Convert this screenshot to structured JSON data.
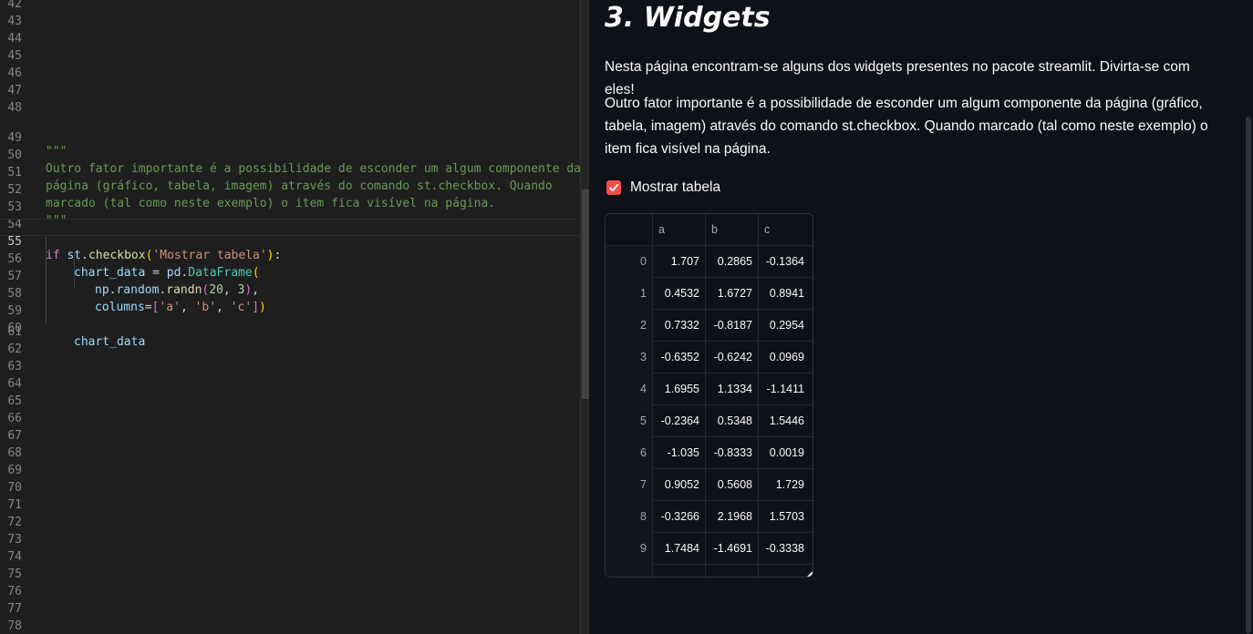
{
  "editor": {
    "blank_line_numbers": [
      "42",
      "43",
      "44",
      "45",
      "46",
      "47",
      "48"
    ],
    "lines": {
      "49": {
        "num": "49",
        "comment": "\"\"\""
      },
      "50": {
        "num": "50",
        "comment": "Outro fator importante é a possibilidade de esconder um algum componente da"
      },
      "51": {
        "num": "51",
        "comment": "página (gráfico, tabela, imagem) através do comando st.checkbox. Quando"
      },
      "52": {
        "num": "52",
        "comment": "marcado (tal como neste exemplo) o item fica visível na página."
      },
      "53": {
        "num": "53",
        "comment": "\"\"\""
      },
      "54": {
        "num": "54"
      },
      "55": {
        "num": "55",
        "kw_if": "if",
        "st": "st",
        "dot": ".",
        "fn": "checkbox",
        "lp": "(",
        "str": "'Mostrar tabela'",
        "rp": ")",
        "colon": ":"
      },
      "56": {
        "num": "56",
        "var": "chart_data",
        "eq": " = ",
        "pd": "pd",
        "dot": ".",
        "cls": "DataFrame",
        "lp": "("
      },
      "57": {
        "num": "57",
        "np": "np",
        "dot1": ".",
        "random": "random",
        "dot2": ".",
        "fn": "randn",
        "lp": "(",
        "n1": "20",
        "comma": ", ",
        "n2": "3",
        "rp": ")",
        "trail": ","
      },
      "58": {
        "num": "58",
        "param": "columns",
        "eq": "=",
        "lb": "[",
        "s1": "'a'",
        "c1": ", ",
        "s2": "'b'",
        "c2": ", ",
        "s3": "'c'",
        "rb": "]",
        "rp": ")"
      },
      "59": {
        "num": "59"
      },
      "60": {
        "num": "60",
        "var": "chart_data"
      }
    },
    "tail_line_numbers": [
      "61",
      "62",
      "63",
      "64",
      "65",
      "66",
      "67",
      "68",
      "69",
      "70",
      "71",
      "72",
      "73",
      "74",
      "75",
      "76",
      "77",
      "78"
    ]
  },
  "app": {
    "title": "3. Widgets",
    "paragraph1": "Nesta página encontram-se alguns dos widgets presentes no pacote streamlit. Divirta-se com eles!",
    "paragraph2": "Outro fator importante é a possibilidade de esconder um algum componente da página (gráfico, tabela, imagem) através do comando st.checkbox. Quando marcado (tal como neste exemplo) o item fica visível na página.",
    "checkbox": {
      "label": "Mostrar tabela",
      "checked": true,
      "color": "#ff4b4b"
    },
    "table": {
      "columns": [
        "a",
        "b",
        "c"
      ],
      "rows": [
        {
          "index": "0",
          "a": "1.707",
          "b": "0.2865",
          "c": "-0.1364"
        },
        {
          "index": "1",
          "a": "0.4532",
          "b": "1.6727",
          "c": "0.8941"
        },
        {
          "index": "2",
          "a": "0.7332",
          "b": "-0.8187",
          "c": "0.2954"
        },
        {
          "index": "3",
          "a": "-0.6352",
          "b": "-0.6242",
          "c": "0.0969"
        },
        {
          "index": "4",
          "a": "1.6955",
          "b": "1.1334",
          "c": "-1.1411"
        },
        {
          "index": "5",
          "a": "-0.2364",
          "b": "0.5348",
          "c": "1.5446"
        },
        {
          "index": "6",
          "a": "-1.035",
          "b": "-0.8333",
          "c": "0.0019"
        },
        {
          "index": "7",
          "a": "0.9052",
          "b": "0.5608",
          "c": "1.729"
        },
        {
          "index": "8",
          "a": "-0.3266",
          "b": "2.1968",
          "c": "1.5703"
        },
        {
          "index": "9",
          "a": "1.7484",
          "b": "-1.4691",
          "c": "-0.3338"
        }
      ]
    }
  },
  "colors": {
    "editor_bg": "#1e1e1e",
    "app_bg": "#0e1117",
    "accent": "#ff4b4b",
    "comment": "#6a9955",
    "string": "#ce9178"
  }
}
